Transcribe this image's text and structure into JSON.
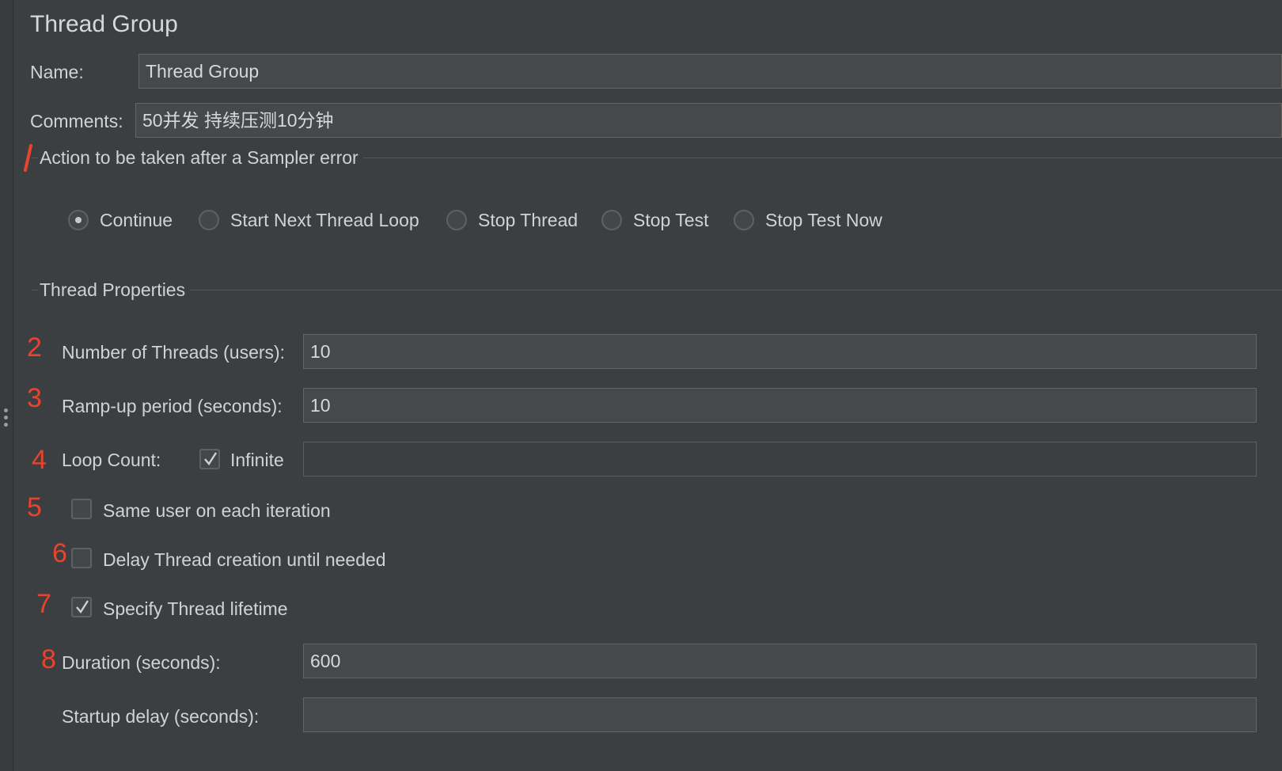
{
  "panel": {
    "title": "Thread Group"
  },
  "name_field": {
    "label": "Name:",
    "value": "Thread Group"
  },
  "comments_field": {
    "label": "Comments:",
    "value": "50并发 持续压测10分钟"
  },
  "sampler_error": {
    "title": "Action to be taken after a Sampler error",
    "options": [
      {
        "label": "Continue",
        "selected": true
      },
      {
        "label": "Start Next Thread Loop",
        "selected": false
      },
      {
        "label": "Stop Thread",
        "selected": false
      },
      {
        "label": "Stop Test",
        "selected": false
      },
      {
        "label": "Stop Test Now",
        "selected": false
      }
    ]
  },
  "thread_properties": {
    "title": "Thread Properties",
    "num_threads": {
      "label": "Number of Threads (users):",
      "value": "10"
    },
    "ramp_up": {
      "label": "Ramp-up period (seconds):",
      "value": "10"
    },
    "loop_count": {
      "label": "Loop Count:",
      "infinite_label": "Infinite",
      "infinite_checked": true,
      "value": ""
    },
    "same_user": {
      "label": "Same user on each iteration",
      "checked": false
    },
    "delay_thread": {
      "label": "Delay Thread creation until needed",
      "checked": false
    },
    "specify_lifetime": {
      "label": "Specify Thread lifetime",
      "checked": true
    },
    "duration": {
      "label": "Duration (seconds):",
      "value": "600"
    },
    "startup_delay": {
      "label": "Startup delay (seconds):",
      "value": ""
    }
  },
  "annotations": [
    "2",
    "3",
    "4",
    "5",
    "6",
    "7",
    "8"
  ],
  "colors": {
    "background": "#3c3f41",
    "field_bg": "#45494a",
    "text": "#d0d2d4",
    "annotation": "#e8432e"
  }
}
